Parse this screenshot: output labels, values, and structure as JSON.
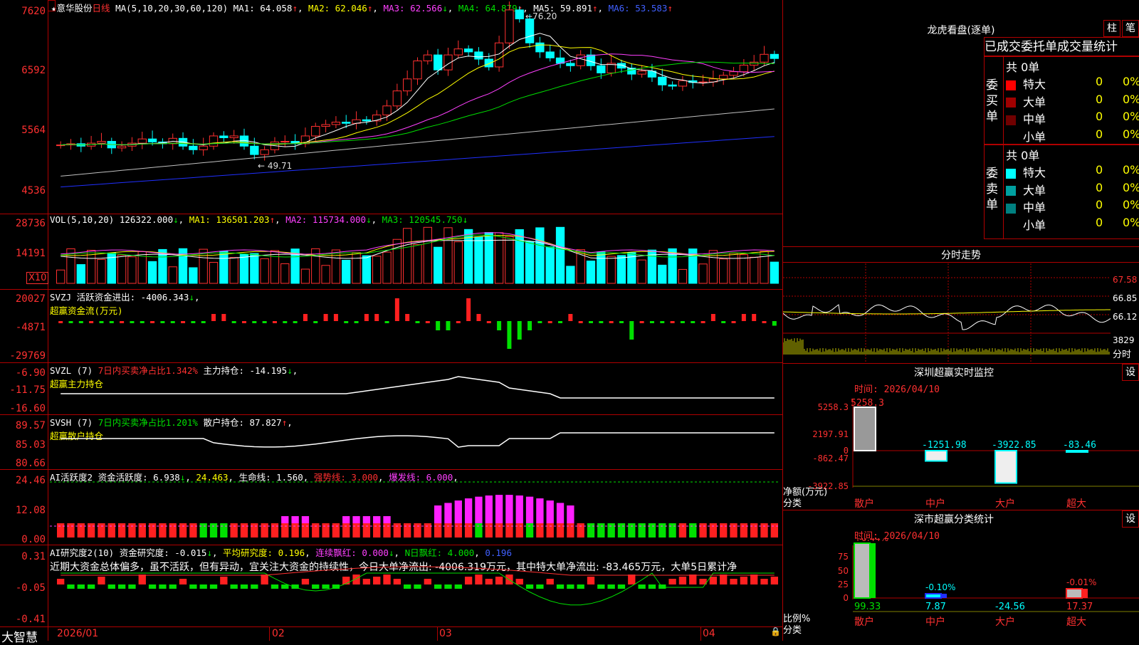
{
  "stock": {
    "name": "★意华股份",
    "period": "日线",
    "ma_params": "MA(5,10,20,30,60,120)",
    "ma1": "MA1: 64.058",
    "ma2": "MA2: 62.046",
    "ma3": "MA3: 62.566",
    "ma4": "MA4: 64.879",
    "ma5": "MA5: 59.891",
    "ma6": "MA6: 53.583",
    "high_mark": "76.20",
    "low_mark": "49.71"
  },
  "price_axis": [
    "7620",
    "6592",
    "5564",
    "4536"
  ],
  "vol": {
    "label": "VOL(5,10,20)",
    "value": "126322.000",
    "ma1": "MA1: 136501.203",
    "ma2": "MA2: 115734.000",
    "ma3": "MA3: 120545.750",
    "axis": [
      "28736",
      "14191"
    ],
    "unit": "X10"
  },
  "svzj": {
    "label": "SVZJ  活跃资金进出: -4006.343",
    "sub": "超赢资金流(万元)",
    "axis": [
      "20027",
      "-4871",
      "-29769"
    ]
  },
  "svzl": {
    "label": "SVZL (7)",
    "pct": "7日内买卖净占比1.342%",
    "hold": "主力持仓: -14.195",
    "sub": "超赢主力持仓",
    "axis": [
      "-6.90",
      "-11.75",
      "-16.60"
    ]
  },
  "svsh": {
    "label": "SVSH (7)",
    "pct": "7日内买卖净占比1.201%",
    "hold": "散户持仓: 87.827",
    "sub": "超赢散户持仓",
    "axis": [
      "89.57",
      "85.03",
      "80.66"
    ]
  },
  "ai1": {
    "label": "AI活跃度2",
    "v1": "资金活跃度: 6.938",
    "v2": "24.463",
    "v3": "生命线: 1.560",
    "v4": "强势线: 3.000",
    "v5": "爆发线: 6.000",
    "axis": [
      "24.46",
      "12.08",
      "0.00"
    ]
  },
  "ai2": {
    "label": "AI研究度2(10)",
    "v1": "资金研究度: -0.015",
    "v2": "平均研究度: 0.196",
    "v3": "连续飘红: 0.000",
    "v4": "N日飘红: 4.000",
    "v5": "0.196",
    "axis": [
      "0.31",
      "-0.05",
      "-0.41"
    ],
    "comment": "近期大资金总体偏多，虽不活跃，但有异动，宜关注大资金的持续性，今日大单净流出: -4006.319万元，其中特大单净流出: -83.465万元，大单5日累计净"
  },
  "date_axis": [
    "2026/01",
    "02",
    "03",
    "04"
  ],
  "brand": "大智慧",
  "right": {
    "dragon_title": "龙虎看盘(逐单)",
    "btn_zhu": "柱",
    "btn_bi": "笔",
    "tabs": [
      "已成交",
      "委托单",
      "成交量统计"
    ],
    "buy": {
      "label": "委买单",
      "total": "共 0单",
      "rows": [
        {
          "name": "特大",
          "v": "0",
          "p": "0%",
          "color": "#ff0000"
        },
        {
          "name": "大单",
          "v": "0",
          "p": "0%",
          "color": "#a00000"
        },
        {
          "name": "中单",
          "v": "0",
          "p": "0%",
          "color": "#700000"
        },
        {
          "name": "小单",
          "v": "0",
          "p": "0%",
          "color": "#000000"
        }
      ]
    },
    "sell": {
      "label": "委卖单",
      "total": "共 0单",
      "rows": [
        {
          "name": "特大",
          "v": "0",
          "p": "0%",
          "color": "#00ffff"
        },
        {
          "name": "大单",
          "v": "0",
          "p": "0%",
          "color": "#00a0a0"
        },
        {
          "name": "中单",
          "v": "0",
          "p": "0%",
          "color": "#008080"
        },
        {
          "name": "小单",
          "v": "0",
          "p": "0%",
          "color": "#000000"
        }
      ]
    },
    "intraday": {
      "title": "分时走势",
      "axis": [
        "67.58",
        "66.85",
        "66.12"
      ],
      "vol": "3829",
      "fen": "分时"
    },
    "monitor": {
      "title": "深圳超赢实时监控",
      "btn": "设",
      "time": "时间: 2026/04/10",
      "axis": [
        "5258.3",
        "2197.91",
        "0",
        "-862.47",
        "-3922.85"
      ],
      "values": [
        "5258.3",
        "-1251.98",
        "-3922.85",
        "-83.46"
      ],
      "cats": [
        "散户",
        "中户",
        "大户",
        "超大"
      ],
      "ylabel": "净额(万元)",
      "xlabel": "分类"
    },
    "stats": {
      "title": "深市超赢分类统计",
      "btn": "设",
      "time": "时间: 2026/04/10",
      "axis": [
        "75",
        "50",
        "25",
        "0"
      ],
      "top": [
        "+0.44%",
        "-0.10%",
        "-0.01%"
      ],
      "bottom": [
        "99.33",
        "7.87",
        "-24.56",
        "17.37"
      ],
      "cats": [
        "散户",
        "中户",
        "大户",
        "超大"
      ],
      "ylabel": "比例%",
      "xlabel": "分类"
    }
  }
}
